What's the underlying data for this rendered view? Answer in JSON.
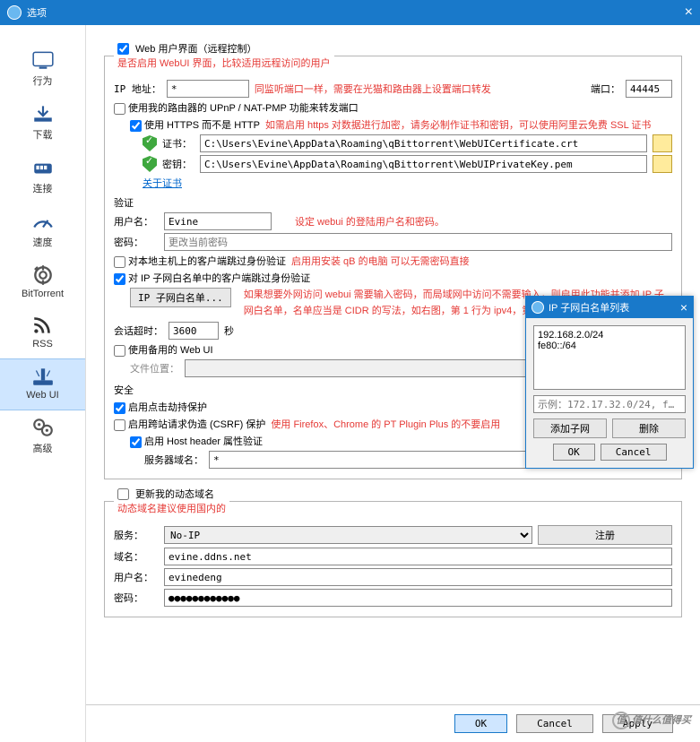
{
  "window": {
    "title": "选项",
    "close": "×"
  },
  "sidebar": {
    "items": [
      {
        "label": "行为"
      },
      {
        "label": "下载"
      },
      {
        "label": "连接"
      },
      {
        "label": "速度"
      },
      {
        "label": "BitTorrent"
      },
      {
        "label": "RSS"
      },
      {
        "label": "Web UI"
      },
      {
        "label": "高级"
      }
    ]
  },
  "webui": {
    "legend": "Web 用户界面（远程控制）",
    "legend_note": "是否启用 WebUI 界面，比较适用远程访问的用户",
    "ip_label": "IP 地址：",
    "ip_value": "*",
    "ip_note": "同监听端口一样，需要在光猫和路由器上设置端口转发",
    "port_label": "端口：",
    "port_value": "44445",
    "upnp": "使用我的路由器的 UPnP / NAT-PMP 功能来转发端口",
    "https": "使用 HTTPS 而不是 HTTP",
    "https_note": "如需启用 https 对数据进行加密，请务必制作证书和密钥，可以使用阿里云免费 SSL 证书",
    "cert_label": "证书：",
    "cert_value": "C:\\Users\\Evine\\AppData\\Roaming\\qBittorrent\\WebUICertificate.crt",
    "key_label": "密钥：",
    "key_value": "C:\\Users\\Evine\\AppData\\Roaming\\qBittorrent\\WebUIPrivateKey.pem",
    "about_cert": "关于证书",
    "auth_header": "验证",
    "user_label": "用户名：",
    "user_value": "Evine",
    "user_note": "设定 webui 的登陆用户名和密码。",
    "pass_label": "密码：",
    "pass_placeholder": "更改当前密码",
    "bypass_local": "对本地主机上的客户端跳过身份验证",
    "bypass_local_note": "启用用安装 qB 的电脑 可以无需密码直接",
    "bypass_subnet": "对 IP 子网白名单中的客户端跳过身份验证",
    "subnet_btn": "IP 子网白名单...",
    "subnet_note": "如果想要外网访问 webui 需要输入密码，而局域网中访问不需要输入，则启用此功能并添加 IP 子网白名单，名单应当是 CIDR 的写法，如右图，第 1 行为 ipv4，第 2 行为 ipv6。",
    "session_label": "会话超时：",
    "session_value": "3600",
    "session_unit": "秒",
    "alt_webui": "使用备用的 Web UI",
    "file_location": "文件位置：",
    "security_header": "安全",
    "clickjack": "启用点击劫持保护",
    "csrf": "启用跨站请求伪造 (CSRF) 保护",
    "csrf_note": "使用 Firefox、Chrome 的 PT Plugin Plus 的不要启用",
    "host_header": "启用 Host header 属性验证",
    "server_domain_label": "服务器域名：",
    "server_domain_value": "*",
    "dyndns_header": "更新我的动态域名",
    "dyndns_note": "动态域名建议使用国内的",
    "service_label": "服务：",
    "service_value": "No-IP",
    "register_btn": "注册",
    "domain_label": "域名：",
    "domain_value": "evine.ddns.net",
    "dd_user_label": "用户名：",
    "dd_user_value": "evinedeng",
    "dd_pass_label": "密码：",
    "dd_pass_value": "●●●●●●●●●●●●"
  },
  "dialog": {
    "title": "IP 子网白名单列表",
    "entries": [
      "192.168.2.0/24",
      "fe80::/64"
    ],
    "example": "示例：172.17.32.0/24, f…",
    "add": "添加子网",
    "del": "删除",
    "ok": "OK",
    "cancel": "Cancel"
  },
  "buttons": {
    "ok": "OK",
    "cancel": "Cancel",
    "apply": "Apply"
  },
  "watermark": "值什么值得买"
}
